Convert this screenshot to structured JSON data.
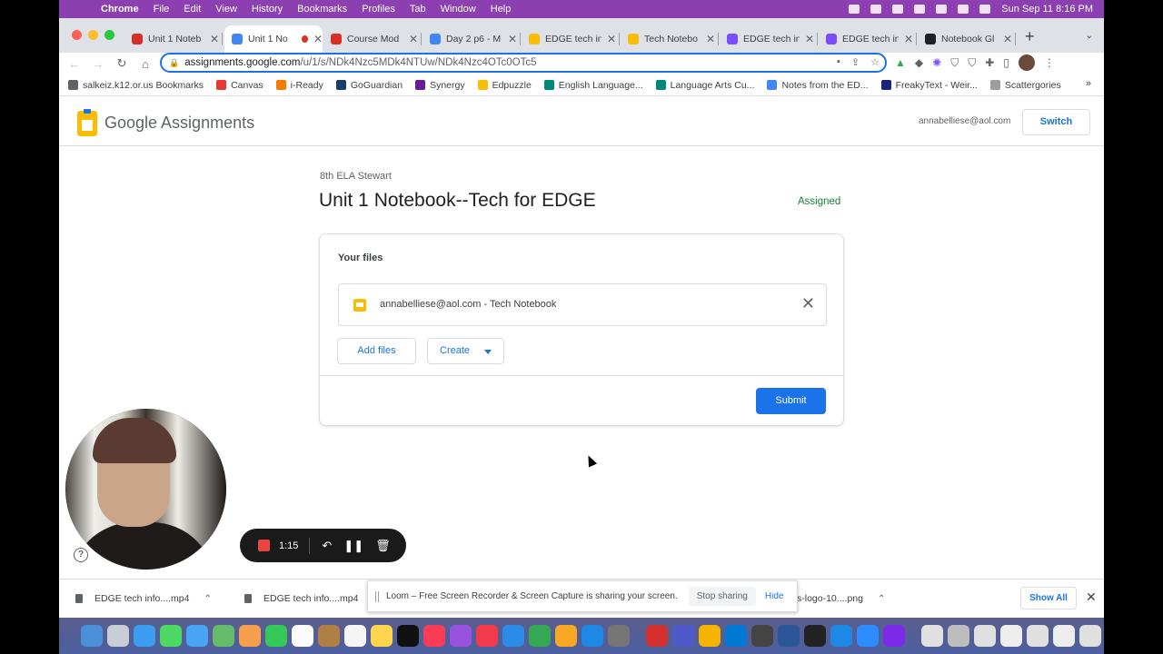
{
  "menubar": {
    "app": "Chrome",
    "items": [
      "File",
      "Edit",
      "View",
      "History",
      "Bookmarks",
      "Profiles",
      "Tab",
      "Window",
      "Help"
    ],
    "datetime": "Sun Sep 11  8:16 PM"
  },
  "tabs": [
    {
      "label": "Unit 1 Noteb",
      "color": "#d93025"
    },
    {
      "label": "Unit 1 No",
      "color": "#4285f4",
      "active": true,
      "recording": true
    },
    {
      "label": "Course Mod",
      "color": "#d93025"
    },
    {
      "label": "Day 2 p6 - M",
      "color": "#4285f4"
    },
    {
      "label": "EDGE tech in",
      "color": "#fbbc04"
    },
    {
      "label": "Tech Notebo",
      "color": "#fbbc04"
    },
    {
      "label": "EDGE tech in",
      "color": "#7c4dff"
    },
    {
      "label": "EDGE tech in",
      "color": "#7c4dff"
    },
    {
      "label": "Notebook Gl",
      "color": "#202124"
    }
  ],
  "toolbar": {
    "url_host": "assignments.google.com",
    "url_path": "/u/1/s/NDk4Nzc5MDk4NTUw/NDk4Nzc4OTc0OTc5"
  },
  "bookmarks": [
    {
      "label": "salkeiz.k12.or.us Bookmarks",
      "color": "#5f6368"
    },
    {
      "label": "Canvas",
      "color": "#e53935"
    },
    {
      "label": "i-Ready",
      "color": "#f57c00"
    },
    {
      "label": "GoGuardian",
      "color": "#1a3d6d"
    },
    {
      "label": "Synergy",
      "color": "#6a1b9a"
    },
    {
      "label": "Edpuzzle",
      "color": "#fbbc04"
    },
    {
      "label": "English Language...",
      "color": "#00897b"
    },
    {
      "label": "Language Arts Cu...",
      "color": "#00897b"
    },
    {
      "label": "Notes from the ED...",
      "color": "#4285f4"
    },
    {
      "label": "FreakyText - Weir...",
      "color": "#1a237e"
    },
    {
      "label": "Scattergories",
      "color": "#9e9e9e"
    }
  ],
  "bookmarks_more": "»",
  "app": {
    "logo": "Google Assignments",
    "account": "annabelliese@aol.com",
    "switch_label": "Switch"
  },
  "assignment": {
    "class_name": "8th ELA Stewart",
    "title": "Unit 1 Notebook--Tech for EDGE",
    "status": "Assigned",
    "your_files_label": "Your files",
    "file_name": "annabelliese@aol.com - Tech Notebook",
    "add_files_label": "Add files",
    "create_label": "Create",
    "submit_label": "Submit"
  },
  "loom": {
    "time": "1:15",
    "share_message": "Loom – Free Screen Recorder & Screen Capture is sharing your screen.",
    "stop_sharing": "Stop sharing",
    "hide": "Hide"
  },
  "downloads": {
    "items": [
      "EDGE tech info....mp4",
      "EDGE tech info....mp4",
      "s-logo-10....png"
    ],
    "show_all": "Show All"
  },
  "icons": {
    "help": "?",
    "close": "✕",
    "new_tab": "+"
  }
}
